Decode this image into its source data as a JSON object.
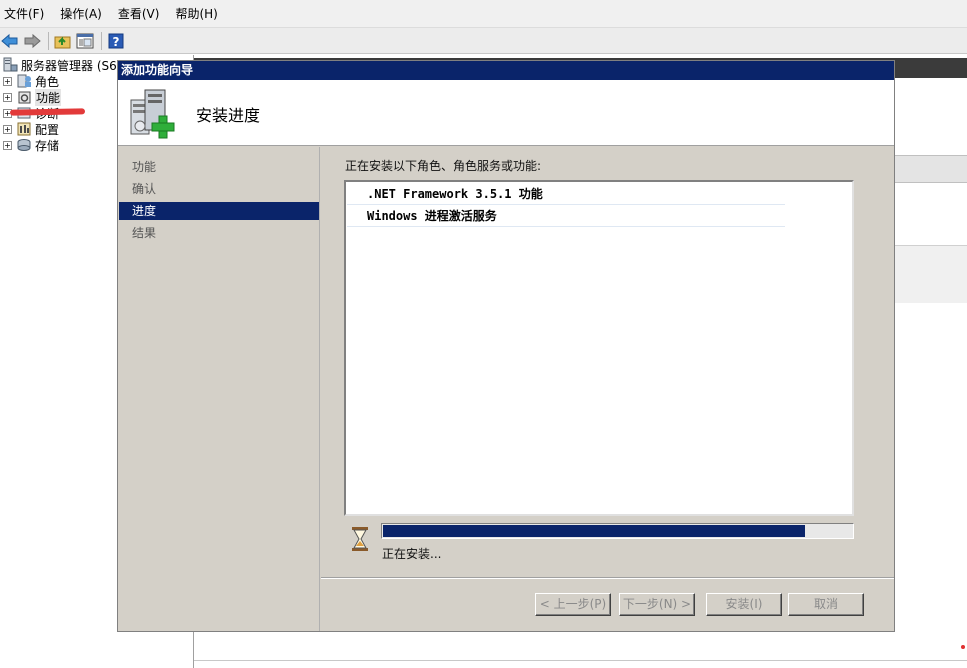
{
  "menu": [
    "文件(F)",
    "操作(A)",
    "查看(V)",
    "帮助(H)"
  ],
  "toolbar": {
    "icons": [
      "back-arrow-icon",
      "forward-arrow-icon",
      "up-folder-icon",
      "show-hide-tree-icon",
      "help-icon"
    ]
  },
  "tree": {
    "root_label": "服务器管理器 (S6",
    "items": [
      {
        "label": "角色",
        "icon": "roles-icon"
      },
      {
        "label": "功能",
        "icon": "features-icon"
      },
      {
        "label": "诊断",
        "icon": "diagnostics-icon"
      },
      {
        "label": "配置",
        "icon": "configuration-icon"
      },
      {
        "label": "存储",
        "icon": "storage-icon"
      }
    ]
  },
  "wizard": {
    "title": "添加功能向导",
    "heading": "安装进度",
    "steps": [
      "功能",
      "确认",
      "进度",
      "结果"
    ],
    "active_step": "进度",
    "caption": "正在安装以下角色、角色服务或功能:",
    "items": [
      ".NET Framework 3.5.1 功能",
      "Windows 进程激活服务"
    ],
    "progress_fraction": 0.9,
    "progress_text": "正在安装...",
    "buttons": {
      "prev": "< 上一步(P)",
      "next": "下一步(N) >",
      "install": "安装(I)",
      "cancel": "取消"
    }
  },
  "colors": {
    "title_bar": "#0a246a",
    "dialog_bg": "#d4d0c8",
    "progress_fill": "#0a246a",
    "highlight_mark": "#e23a3a"
  }
}
